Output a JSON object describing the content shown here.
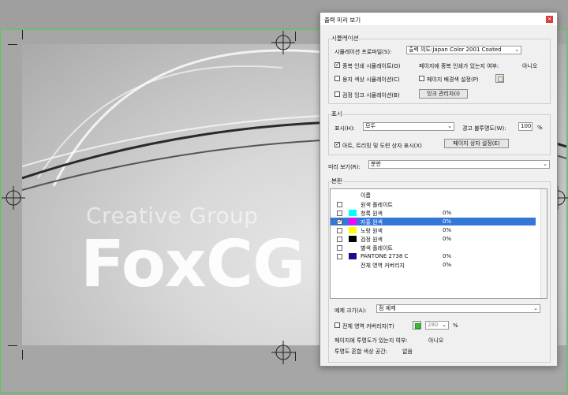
{
  "document": {
    "brand_sub": "Creative Group",
    "brand_main": "FoxCG"
  },
  "dialog": {
    "title": "출력 미리 보기",
    "close_icon": "close-icon",
    "simulation": {
      "group_label": "시뮬레이션",
      "profile_label": "시뮬레이션 프로파일(S):",
      "profile_value": "출력 의도:Japan Color 2001 Coated",
      "overprint_label": "중복 인쇄 시뮬레이트(O)",
      "overprint_checked": true,
      "overprint_question": "페이지에 중복 인쇄가 있는지 여부:",
      "overprint_answer": "아니오",
      "paper_color_label": "용지 색상 시뮬레이션(C)",
      "paper_color_checked": false,
      "page_bg_label": "페이지 배경색 설정(P)",
      "page_bg_checked": false,
      "black_ink_label": "검정 잉크 시뮬레이션(B)",
      "black_ink_checked": false,
      "ink_manager_label": "잉크 관리자(I)"
    },
    "show": {
      "group_label": "표시",
      "show_label": "표시(H):",
      "show_value": "모두",
      "warn_opacity_label": "경고 불투명도(W):",
      "warn_opacity_value": "100",
      "percent": "%",
      "art_trim_label": "아트, 트리밍 및 도련 상자 표시(X)",
      "art_trim_checked": true,
      "page_box_button": "페이지 상자 설정(E)"
    },
    "preview": {
      "label": "미리 보기(R):",
      "value": "분판"
    },
    "separations": {
      "group_label": "분판",
      "header_name": "이름",
      "rows": [
        {
          "name": "원색 플레이트",
          "pct": "",
          "checked": false,
          "color": "",
          "selected": false
        },
        {
          "name": "청록 원색",
          "pct": "0%",
          "checked": false,
          "color": "#00ffff",
          "selected": false
        },
        {
          "name": "자홍 원색",
          "pct": "0%",
          "checked": true,
          "color": "#ff00ff",
          "selected": true
        },
        {
          "name": "노랑 원색",
          "pct": "0%",
          "checked": false,
          "color": "#ffff00",
          "selected": false
        },
        {
          "name": "검정 원색",
          "pct": "0%",
          "checked": false,
          "color": "#000000",
          "selected": false
        },
        {
          "name": "별색 플레이트",
          "pct": "",
          "checked": false,
          "color": "",
          "selected": false
        },
        {
          "name": "PANTONE 2738 C",
          "pct": "0%",
          "checked": false,
          "color": "#1a0f8a",
          "selected": false
        },
        {
          "name": "전체 영역 커버리지",
          "pct": "0%",
          "checked": false,
          "color": "",
          "selected": false
        }
      ]
    },
    "sample_size": {
      "label": "예제 크기(A):",
      "value": "점 예제"
    },
    "coverage": {
      "label": "전체 영역 커버리지(T)",
      "checked": false,
      "color": "#2bc62b",
      "value": "280",
      "percent": "%"
    },
    "transparency": {
      "question": "페이지에 투명도가 있는지 여부:",
      "answer": "아니오",
      "blend_label": "투명도 혼합 색상 공간:",
      "blend_value": "없음"
    }
  }
}
